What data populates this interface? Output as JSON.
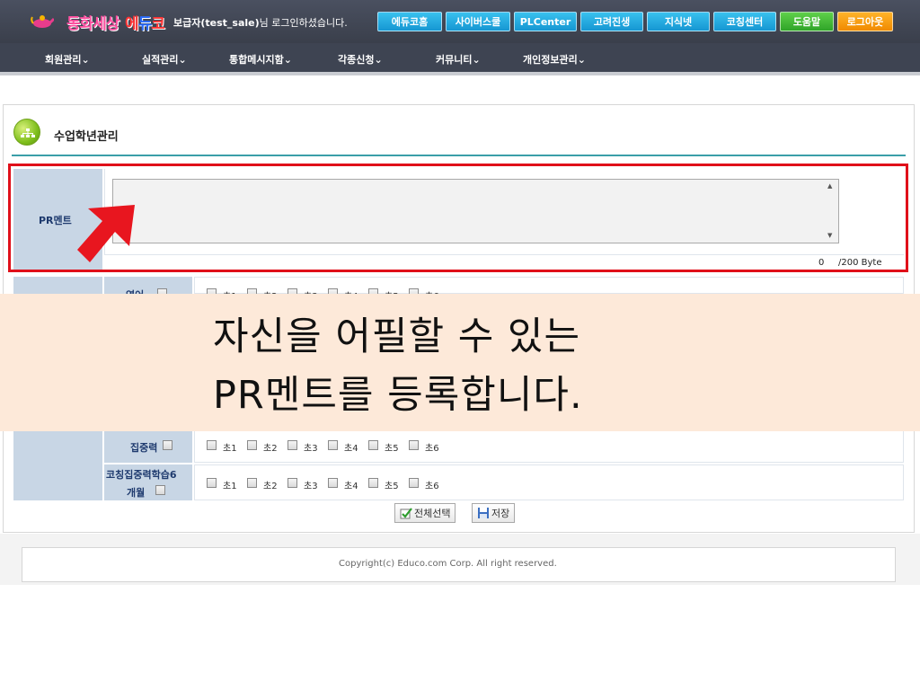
{
  "header": {
    "logo_text_1": "동화세상",
    "logo_text_2a": "에",
    "logo_text_2b": "듀",
    "logo_text_2c": "코",
    "login_user": "보급자(test_sale)",
    "login_suffix": "님 로그인하셨습니다.",
    "top_buttons": [
      {
        "label": "에듀코홈",
        "color": "cyan"
      },
      {
        "label": "사이버스쿨",
        "color": "cyan"
      },
      {
        "label": "PLCenter",
        "color": "cyan"
      },
      {
        "label": "고려진생",
        "color": "cyan"
      },
      {
        "label": "지식넷",
        "color": "cyan"
      },
      {
        "label": "코칭센터",
        "color": "cyan"
      },
      {
        "label": "도움말",
        "color": "green"
      },
      {
        "label": "로그아웃",
        "color": "orange"
      }
    ],
    "menu": [
      {
        "label": "회원관리"
      },
      {
        "label": "실적관리"
      },
      {
        "label": "통합메시지함"
      },
      {
        "label": "각종신청"
      },
      {
        "label": "커뮤니티"
      },
      {
        "label": "개인정보관리"
      }
    ]
  },
  "page": {
    "title": "수업학년관리"
  },
  "pr": {
    "label": "PR멘트",
    "value": "",
    "byte_count": "0",
    "byte_limit": "/200 Byte"
  },
  "subjects": {
    "rows": [
      {
        "name": "영어",
        "grades": [
          "초1",
          "초2",
          "초3",
          "초4",
          "초5",
          "초6"
        ]
      },
      {
        "name": "집중력",
        "grades": [
          "초1",
          "초2",
          "초3",
          "초4",
          "초5",
          "초6"
        ]
      },
      {
        "name_line1": "코칭집중력학습6",
        "name_line2": "개월",
        "grades": [
          "초1",
          "초2",
          "초3",
          "초4",
          "초5",
          "초6"
        ]
      }
    ]
  },
  "caption": {
    "line1": "자신을 어필할 수 있는",
    "line2": "PR멘트를 등록합니다."
  },
  "actions": {
    "select_all": "전체선택",
    "save": "저장"
  },
  "footer": {
    "copyright": "Copyright(c) Educo.com Corp. All right reserved."
  },
  "colors": {
    "header_bg": "#3e4452",
    "label_cell": "#c8d6e5",
    "highlight": "#e0101a",
    "caption_bg": "#fde9d9",
    "title_rule": "#3a9ea8"
  }
}
